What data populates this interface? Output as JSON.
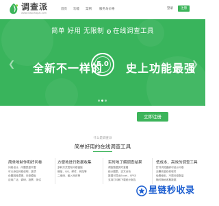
{
  "brand": {
    "name": "调查派",
    "tagline": "www.diaochapai.com",
    "color": "#3cb45a"
  },
  "nav": {
    "items": [
      "首页",
      "功能",
      "案例",
      "服务与价格"
    ],
    "login_label": "登录",
    "register_label": "注册"
  },
  "banner": {
    "slogan_left": "简单 好用 无限制",
    "slogan_sep": "的",
    "slogan_right": "在线调查工具",
    "headline_left": "全新不一样的",
    "version": "5.0",
    "headline_right": "史上功能最强",
    "background_color": "#39b45c",
    "slide_count": 3,
    "active_slide": 1,
    "prev_icon": "chevron-left-icon",
    "next_icon": "chevron-right-icon"
  },
  "cta": {
    "label": "立即注册"
  },
  "features_section": {
    "subtitle": "什么是调查派",
    "title": "简单好用的在线调查工具",
    "items": [
      {
        "title": "简单地制作和好问卷",
        "lines": [
          "问卷设计、问题类型丰富",
          "可以添加问卷说明、选项",
          "设置跳转逻辑、问卷模板",
          "应用广泛、调研、投票、测试"
        ]
      },
      {
        "title": "方便地进行数据收集",
        "lines": [
          "多种方式发布问卷链接",
          "微信、QQ、邮件、网站等",
          "二维码、嵌入网页等",
          ""
        ]
      },
      {
        "title": "实时地了解调查结果",
        "lines": [
          "调查数据实时查看",
          "统计图表、交叉分析",
          "数据可导出Excel、SPSS",
          "支持打印和下载统计报告"
        ]
      },
      {
        "title": "低成本、高效的调查工具",
        "lines": [
          "打开浏览器即可设计问卷",
          "无需安装任何软件",
          "免费使用、不限问卷数量",
          "随时随地收集数据"
        ]
      }
    ]
  },
  "watermark": {
    "text": "星链秒收录",
    "color": "#1e5fd0",
    "icon": "star-link-icon"
  }
}
